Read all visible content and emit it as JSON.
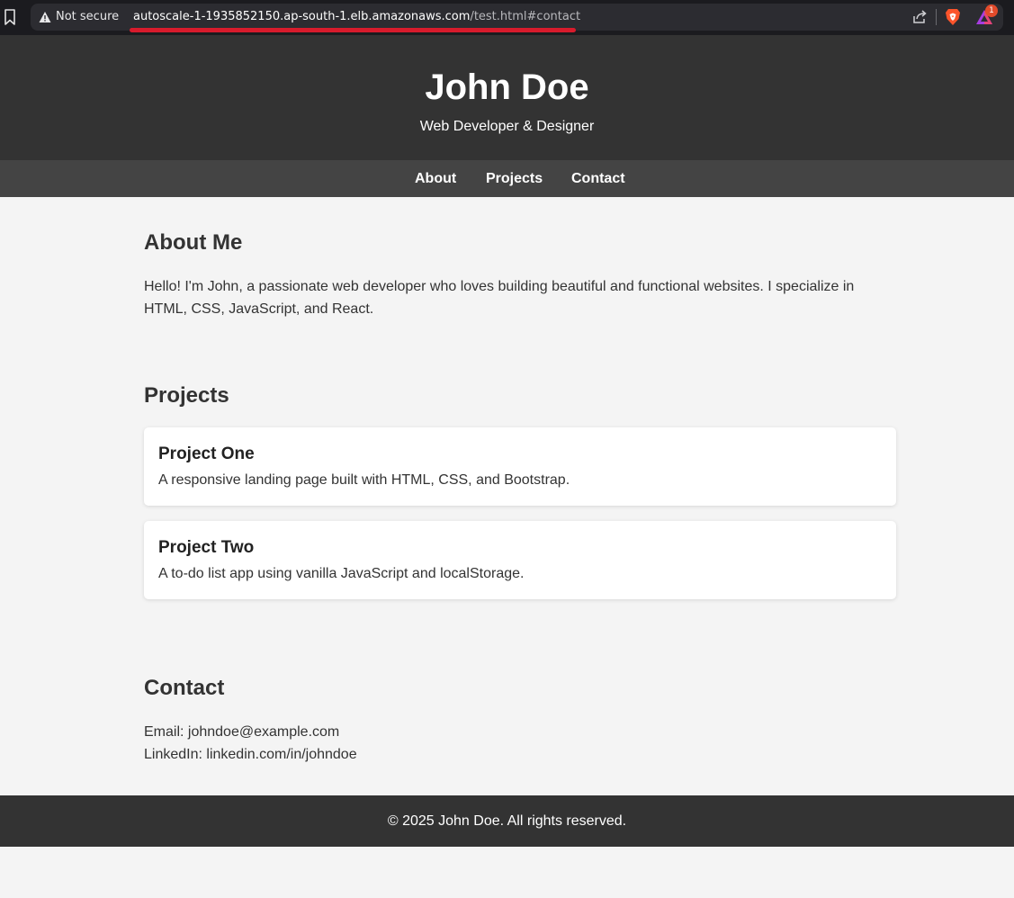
{
  "browser": {
    "security_label": "Not secure",
    "url_host": "autoscale-1-1935852150.ap-south-1.elb.amazonaws.com",
    "url_path": "/test.html#contact",
    "rewards_badge": "1",
    "icons": [
      "bookmark-icon",
      "warning-icon",
      "share-icon",
      "brave-lion-icon",
      "brave-rewards-icon"
    ]
  },
  "header": {
    "title": "John Doe",
    "subtitle": "Web Developer & Designer"
  },
  "nav": {
    "items": [
      {
        "label": "About"
      },
      {
        "label": "Projects"
      },
      {
        "label": "Contact"
      }
    ]
  },
  "about": {
    "heading": "About Me",
    "text": "Hello! I'm John, a passionate web developer who loves building beautiful and functional websites. I specialize in HTML, CSS, JavaScript, and React."
  },
  "projects": {
    "heading": "Projects",
    "items": [
      {
        "title": "Project One",
        "description": "A responsive landing page built with HTML, CSS, and Bootstrap."
      },
      {
        "title": "Project Two",
        "description": "A to-do list app using vanilla JavaScript and localStorage."
      }
    ]
  },
  "contact": {
    "heading": "Contact",
    "email": "Email: johndoe@example.com",
    "linkedin": "LinkedIn: linkedin.com/in/johndoe"
  },
  "footer": {
    "text": "© 2025 John Doe. All rights reserved."
  },
  "colors": {
    "header_bg": "#333333",
    "nav_bg": "#444444",
    "page_bg": "#f4f4f4",
    "url_underline": "#d81b2c"
  }
}
